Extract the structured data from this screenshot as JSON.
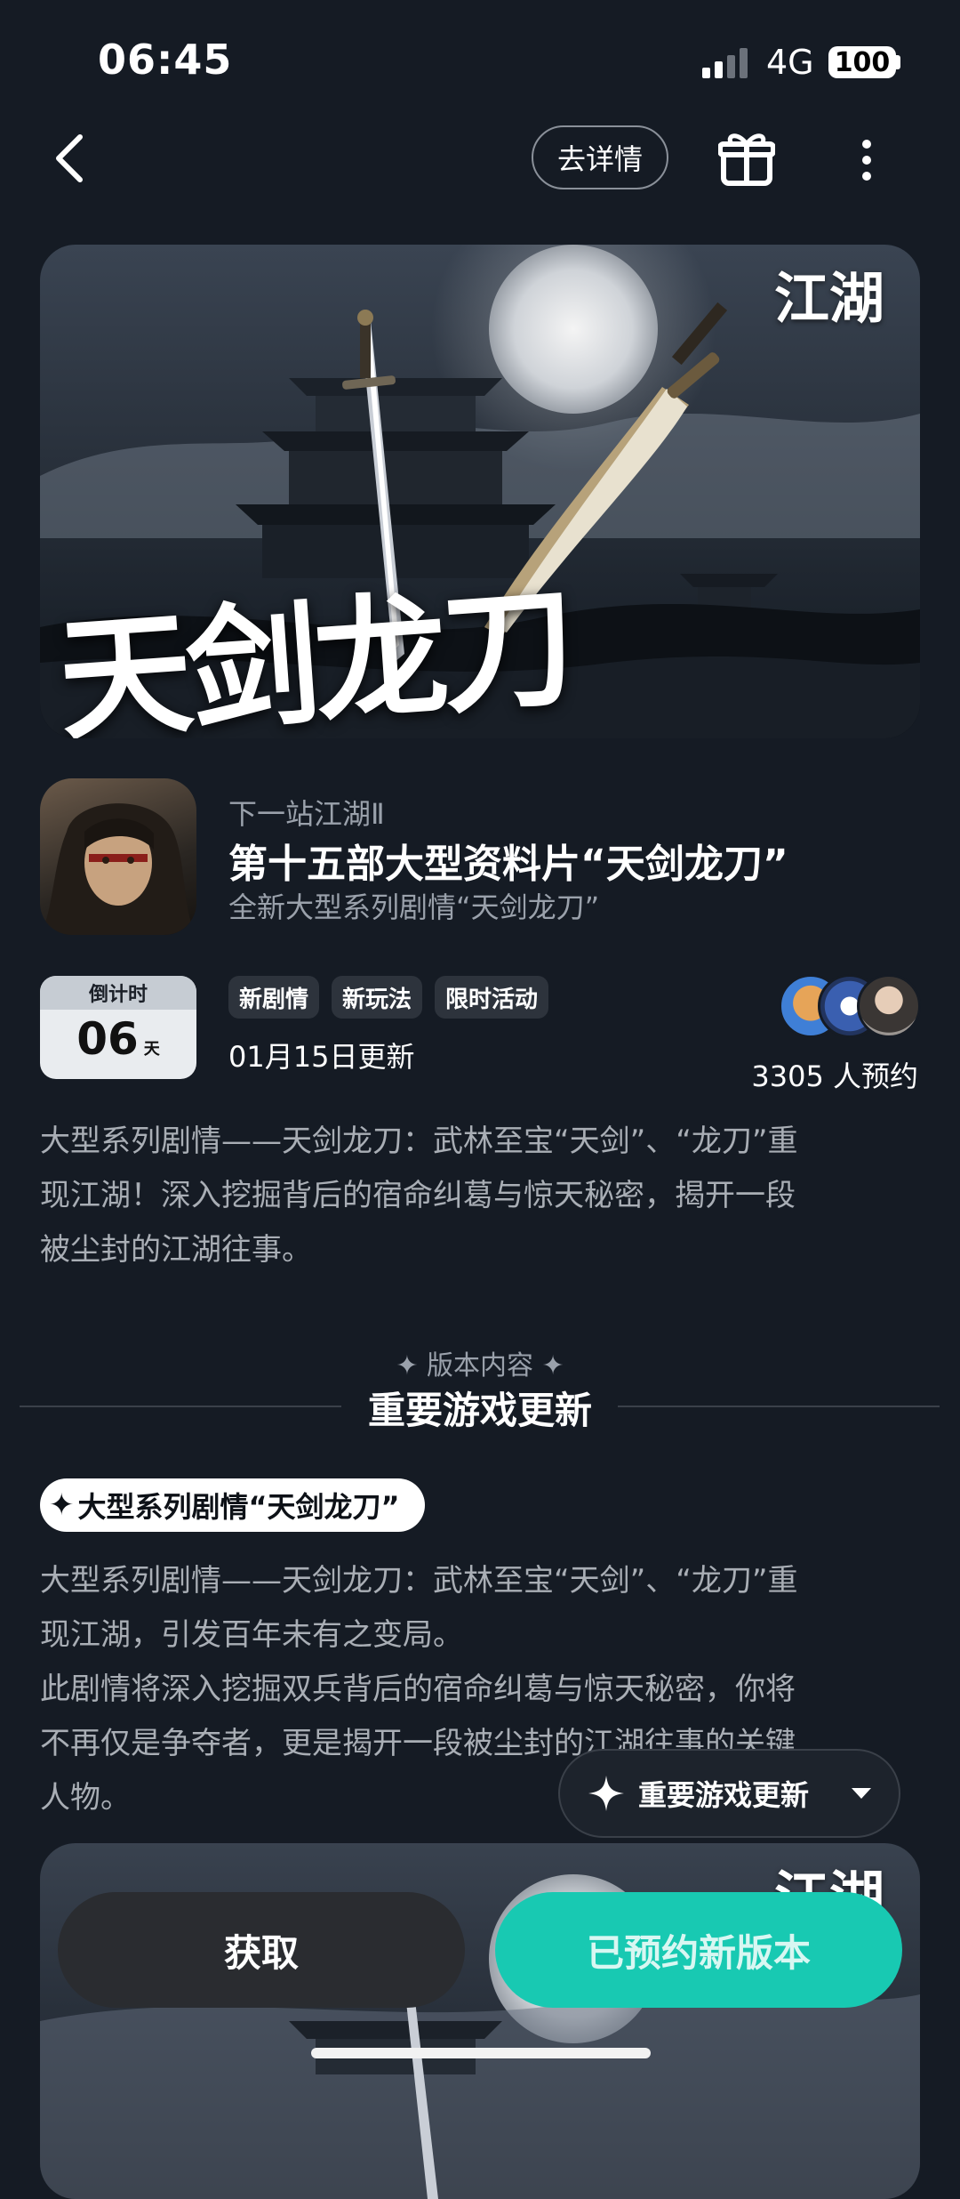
{
  "status_bar": {
    "time": "06:45",
    "network": "4G",
    "battery": "100"
  },
  "nav": {
    "detail_label": "去详情"
  },
  "banner": {
    "title_art": "天剑龙刀",
    "logo_text": "江湖"
  },
  "app": {
    "name": "下一站江湖Ⅱ",
    "headline": "第十五部大型资料片“天剑龙刀”",
    "subtitle": "全新大型系列剧情“天剑龙刀”"
  },
  "countdown": {
    "label": "倒计时",
    "value": "06",
    "unit": "天"
  },
  "tags": [
    "新剧情",
    "新玩法",
    "限时活动"
  ],
  "update_date": "01月15日更新",
  "reservations": "3305 人预约",
  "description": [
    "大型系列剧情——天剑龙刀：武林至宝“天剑”、“龙刀”重",
    "现江湖！深入挖掘背后的宿命纠葛与惊天秘密，揭开一段",
    "被尘封的江湖往事。"
  ],
  "section": {
    "kicker": "版本内容",
    "title": "重要游戏更新"
  },
  "feature": {
    "pill": "大型系列剧情“天剑龙刀”",
    "paragraph": [
      "大型系列剧情——天剑龙刀：武林至宝“天剑”、“龙刀”重",
      "现江湖，引发百年未有之变局。",
      "此剧情将深入挖掘双兵背后的宿命纠葛与惊天秘密，你将",
      "不再仅是争夺者，更是揭开一段被尘封的江湖往事的关键",
      "人物。"
    ]
  },
  "floating_selector": {
    "label": "重要游戏更新"
  },
  "actions": {
    "get": "获取",
    "reserved": "已预约新版本"
  },
  "colors": {
    "background": "#151b24",
    "accent": "#18c9b2"
  }
}
